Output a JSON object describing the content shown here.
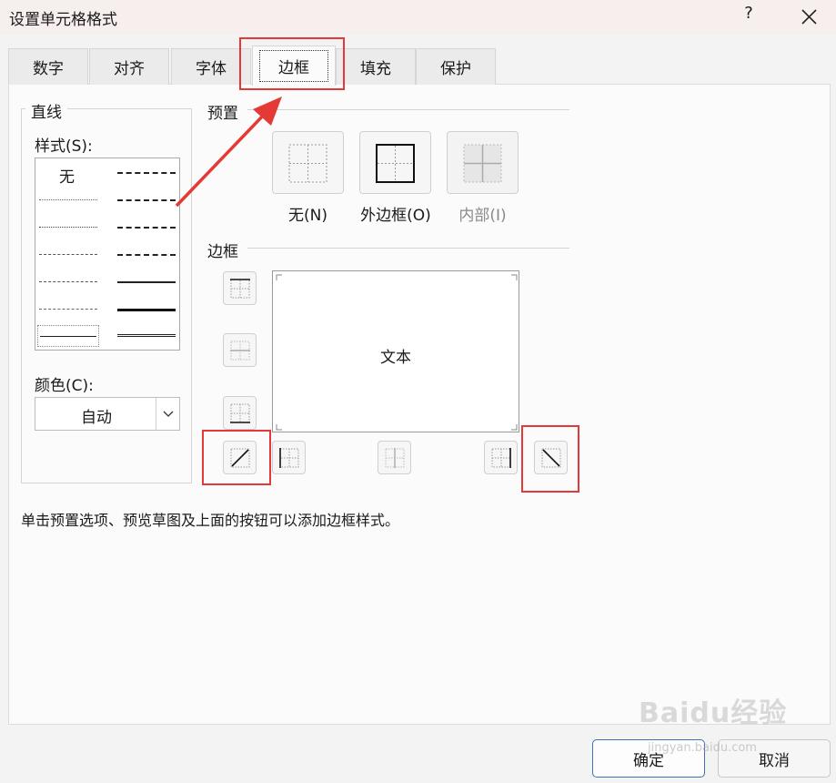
{
  "dialog": {
    "title": "设置单元格格式",
    "help": "?",
    "ok_label": "确定",
    "cancel_label": "取消"
  },
  "tabs": [
    {
      "label": "数字"
    },
    {
      "label": "对齐"
    },
    {
      "label": "字体"
    },
    {
      "label": "边框",
      "active": true
    },
    {
      "label": "填充"
    },
    {
      "label": "保护"
    }
  ],
  "line": {
    "group_label": "直线",
    "style_label": "样式(S):",
    "none_label": "无",
    "color_label": "颜色(C):",
    "color_value": "自动"
  },
  "presets": {
    "group_label": "预置",
    "items": [
      {
        "label": "无(N)",
        "icon": "preset-none-icon",
        "enabled": true
      },
      {
        "label": "外边框(O)",
        "icon": "preset-outline-icon",
        "enabled": true
      },
      {
        "label": "内部(I)",
        "icon": "preset-inside-icon",
        "enabled": false
      }
    ]
  },
  "border": {
    "group_label": "边框",
    "preview_text": "文本"
  },
  "hint": "单击预置选项、预览草图及上面的按钮可以添加边框样式。",
  "colors": {
    "accent": "#3f6fb5",
    "annotation": "#e53935",
    "disabled_text": "#8a8a8a"
  },
  "watermark": {
    "main": "Baidu经验",
    "sub": "jingyan.baidu.com"
  }
}
